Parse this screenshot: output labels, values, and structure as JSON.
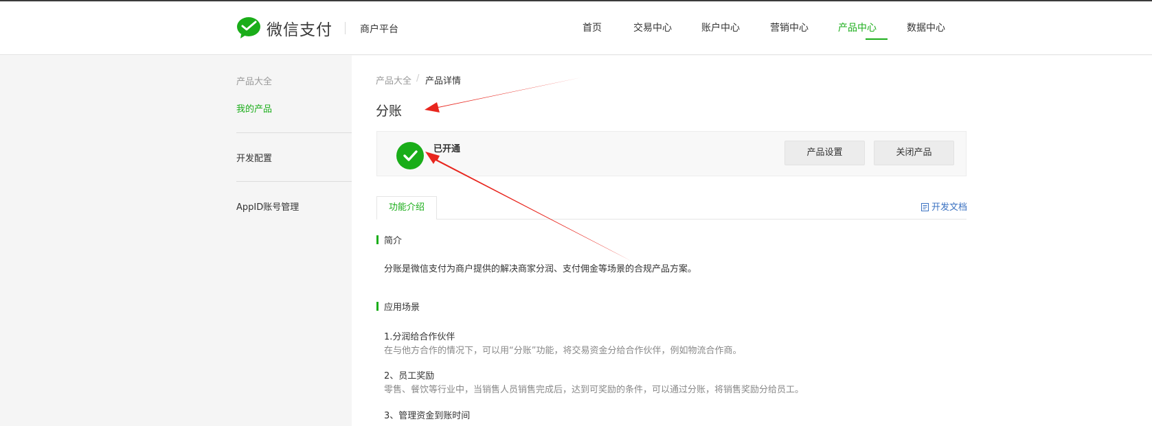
{
  "header": {
    "brand": "微信支付",
    "platform": "商户平台",
    "nav": [
      {
        "label": "首页"
      },
      {
        "label": "交易中心"
      },
      {
        "label": "账户中心"
      },
      {
        "label": "营销中心"
      },
      {
        "label": "产品中心"
      },
      {
        "label": "数据中心"
      }
    ],
    "active_nav": "产品中心"
  },
  "sidebar": {
    "group_label": "产品大全",
    "items": [
      {
        "label": "我的产品"
      },
      {
        "label": "开发配置"
      },
      {
        "label": "AppID账号管理"
      }
    ]
  },
  "breadcrumb": {
    "root": "产品大全",
    "separator": "/",
    "current": "产品详情"
  },
  "page": {
    "title": "分账",
    "status": "已开通",
    "buttons": {
      "settings": "产品设置",
      "close": "关闭产品"
    }
  },
  "tabs": {
    "active": "功能介绍",
    "doc_link": "开发文档"
  },
  "sections": {
    "intro": {
      "title": "简介",
      "text": "分账是微信支付为商户提供的解决商家分润、支付佣金等场景的合规产品方案。"
    },
    "scenarios": {
      "title": "应用场景",
      "items": [
        {
          "title": "1.分润给合作伙伴",
          "desc": "在与他方合作的情况下，可以用“分账”功能，将交易资金分给合作伙伴，例如物流合作商。"
        },
        {
          "title": "2、员工奖励",
          "desc": "零售、餐饮等行业中，当销售人员销售完成后，达到可奖励的条件，可以通过分账，将销售奖励分给员工。"
        },
        {
          "title": "3、管理资金到账时间",
          "desc": ""
        }
      ]
    }
  },
  "colors": {
    "brand_green": "#1aad19",
    "annotation_red": "#e8261e"
  }
}
